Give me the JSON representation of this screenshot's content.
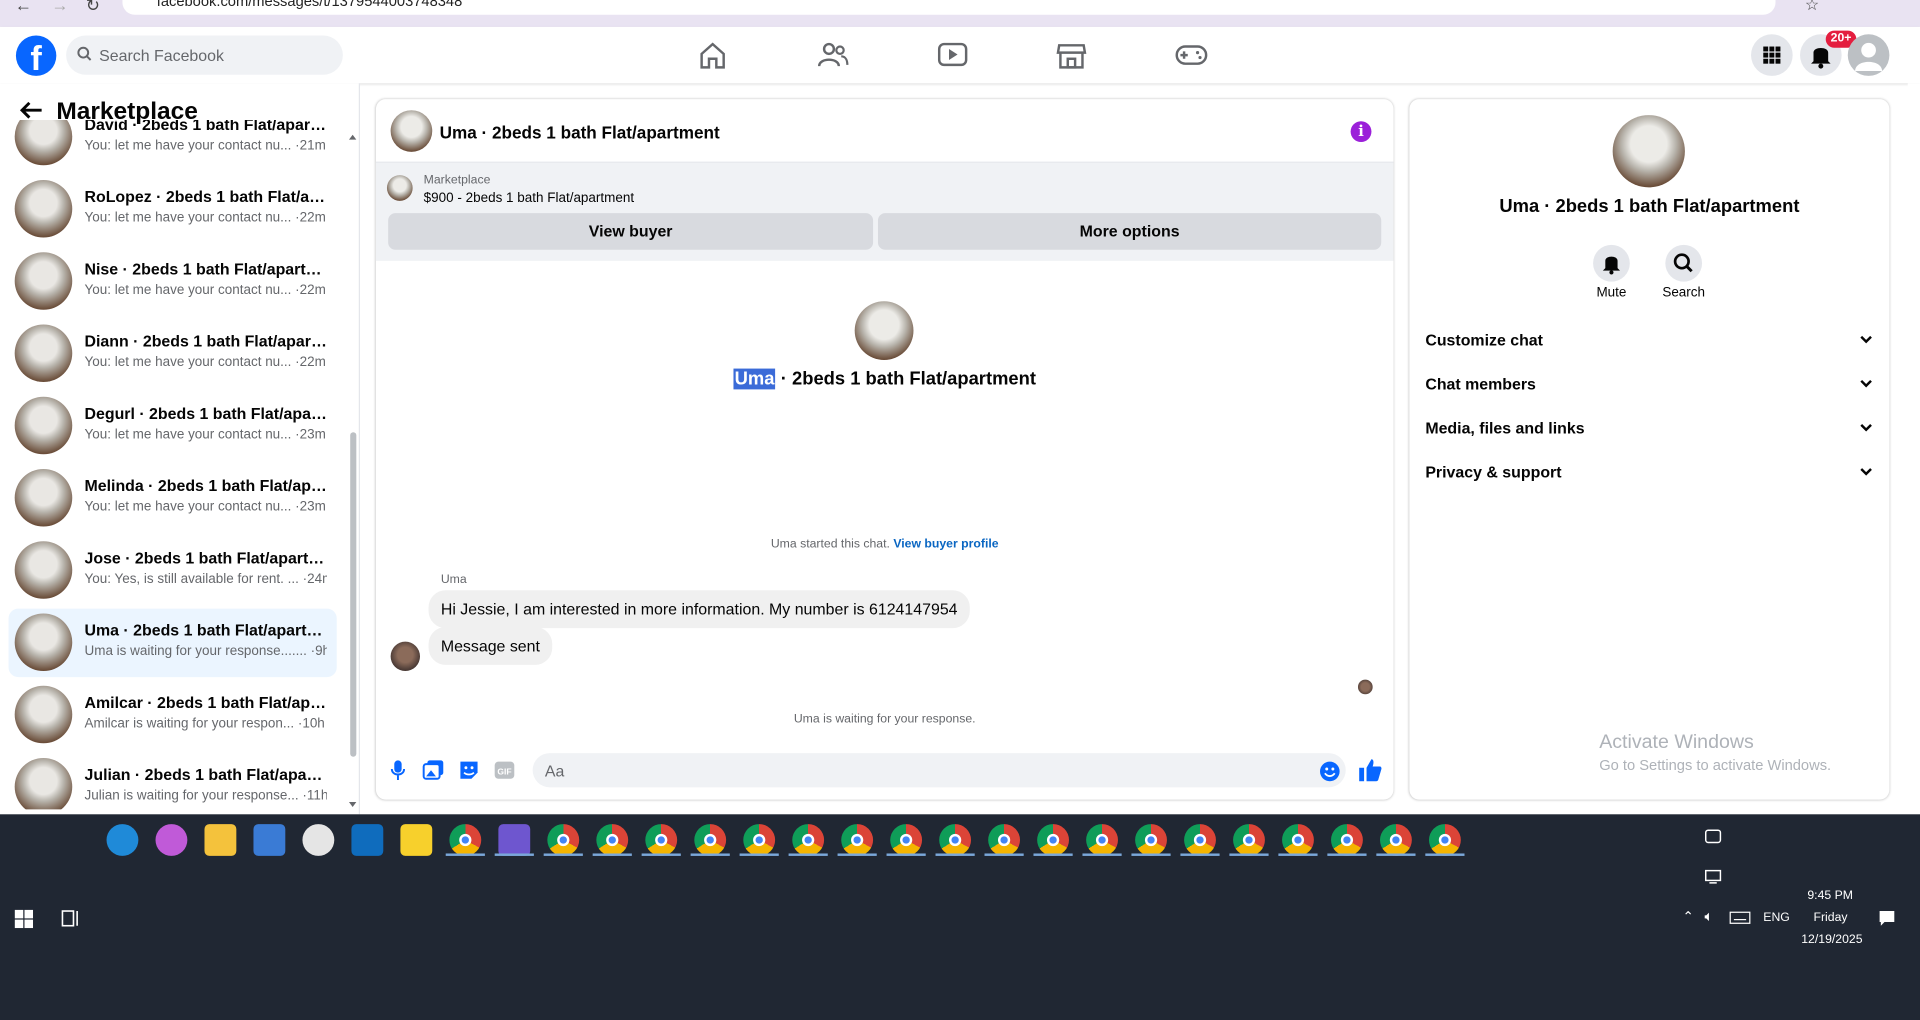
{
  "browser": {
    "url": "facebook.com/messages/t/1379544003748348"
  },
  "header": {
    "search_placeholder": "Search Facebook",
    "notification_badge": "20+",
    "nav_icons": [
      "home-icon",
      "friends-icon",
      "video-icon",
      "marketplace-icon",
      "gaming-icon"
    ]
  },
  "sidebar": {
    "title": "Marketplace",
    "conversations": [
      {
        "name": "David · 2beds 1 bath Flat/apart...",
        "preview": "You: let me have your contact nu...",
        "time": "·21m",
        "selected": false
      },
      {
        "name": "RoLopez · 2beds 1 bath Flat/apa...",
        "preview": "You: let me have your contact nu...",
        "time": "·22m",
        "selected": false
      },
      {
        "name": "Nise · 2beds 1 bath Flat/apartme...",
        "preview": "You: let me have your contact nu...",
        "time": "·22m",
        "selected": false
      },
      {
        "name": "Diann · 2beds 1 bath Flat/apart...",
        "preview": "You: let me have your contact nu...",
        "time": "·22m",
        "selected": false
      },
      {
        "name": "Degurl · 2beds 1 bath Flat/apart...",
        "preview": "You: let me have your contact nu...",
        "time": "·23m",
        "selected": false
      },
      {
        "name": "Melinda · 2beds 1 bath Flat/apar...",
        "preview": "You: let me have your contact nu...",
        "time": "·23m",
        "selected": false
      },
      {
        "name": "Jose · 2beds 1 bath Flat/apartme...",
        "preview": "You: Yes, is still available for rent. ...",
        "time": "·24m",
        "selected": false
      },
      {
        "name": "Uma · 2beds 1 bath Flat/apartm...",
        "preview": "Uma is waiting for your response.......",
        "time": "·9h",
        "selected": true
      },
      {
        "name": "Amilcar · 2beds 1 bath Flat/apart...",
        "preview": "Amilcar is waiting for your respon...",
        "time": "·10h",
        "selected": false
      },
      {
        "name": "Julian · 2beds 1 bath Flat/apart...",
        "preview": "Julian is waiting for your response...",
        "time": "·11h",
        "selected": false
      }
    ]
  },
  "chat": {
    "title": "Uma · 2beds 1 bath Flat/apartment",
    "listing_label": "Marketplace",
    "listing_price": "$900 - 2beds 1 bath Flat/apartment",
    "view_buyer_label": "View buyer",
    "more_options_label": "More options",
    "center_name_highlight": "Uma",
    "center_name_rest": " · 2beds 1 bath Flat/apartment",
    "started_text": "Uma started this chat.",
    "view_buyer_profile": "View buyer profile",
    "sender": "Uma",
    "messages": [
      "Hi Jessie, I am interested in more information. My number is 6124147954",
      "Message sent"
    ],
    "waiting_text": "Uma is waiting for your response.",
    "input_placeholder": "Aa",
    "composer_icons": [
      "microphone-icon",
      "photo-icon",
      "sticker-icon",
      "gif-icon",
      "emoji-icon",
      "like-icon"
    ]
  },
  "right_panel": {
    "name": "Uma · 2beds 1 bath Flat/apartment",
    "mute_label": "Mute",
    "search_label": "Search",
    "sections": [
      "Customize chat",
      "Chat members",
      "Media, files and links",
      "Privacy & support"
    ]
  },
  "watermark": {
    "line1": "Activate Windows",
    "line2": "Go to Settings to activate Windows."
  },
  "taskbar": {
    "time": "9:45 PM",
    "day": "Friday",
    "date": "12/19/2025",
    "lang": "ENG",
    "accent": "#0866ff"
  }
}
